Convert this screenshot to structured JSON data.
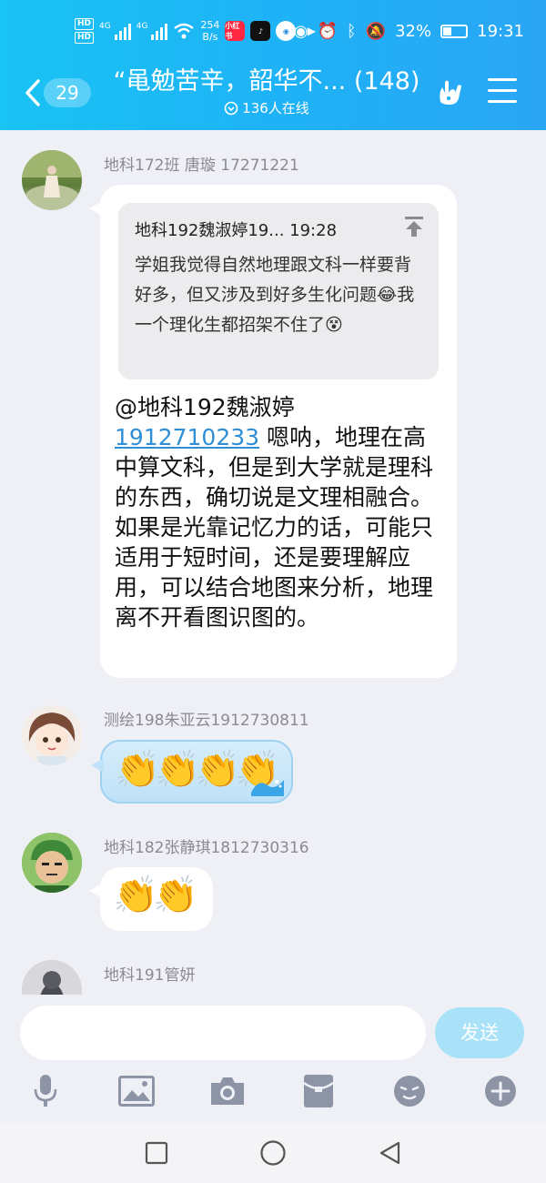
{
  "status_bar": {
    "net_speed": "254",
    "net_unit": "B/s",
    "signal_1": "4G",
    "signal_2": "4G",
    "hd_1": "HD",
    "hd_2": "HD",
    "app_1": "小红书",
    "battery": "32%",
    "time": "19:31"
  },
  "header": {
    "unread_count": "29",
    "title": "“黾勉苦辛，韶华不... (148)",
    "online": "136人在线"
  },
  "messages": [
    {
      "sender": "地科172班 唐璇 17271221",
      "quote": {
        "header": "地科192魏淑婷19... 19:28",
        "text": "学姐我觉得自然地理跟文科一样要背好多，但又涉及到好多生化问题😂我一个理化生都招架不住了😵"
      },
      "mention": "@地科192魏淑婷",
      "mention_number": "1912710233",
      "text": " 嗯呐，地理在高中算文科，但是到大学就是理科的东西，确切说是文理相融合。如果是光靠记忆力的话，可能只适用于短时间，还是要理解应用，可以结合地图来分析，地理离不开看图识图的。"
    },
    {
      "sender": "测绘198朱亚云1912730811",
      "emoji": "👏"
    },
    {
      "sender": "地科182张静琪1812730316",
      "emoji": "👏"
    },
    {
      "sender": "地科191管妍"
    }
  ],
  "input": {
    "placeholder": "",
    "send_label": "发送"
  },
  "colors": {
    "header_start": "#19c3f4",
    "header_end": "#2aa6f5",
    "link": "#2f8fd6",
    "send_button": "#a9e2f8"
  },
  "icons": [
    "back-chevron-icon",
    "online-icon",
    "hand-gesture-icon",
    "menu-icon",
    "pin-icon",
    "microphone-icon",
    "image-icon",
    "camera-icon",
    "red-packet-icon",
    "emoji-icon",
    "plus-icon",
    "square-icon",
    "circle-icon",
    "triangle-back-icon"
  ]
}
